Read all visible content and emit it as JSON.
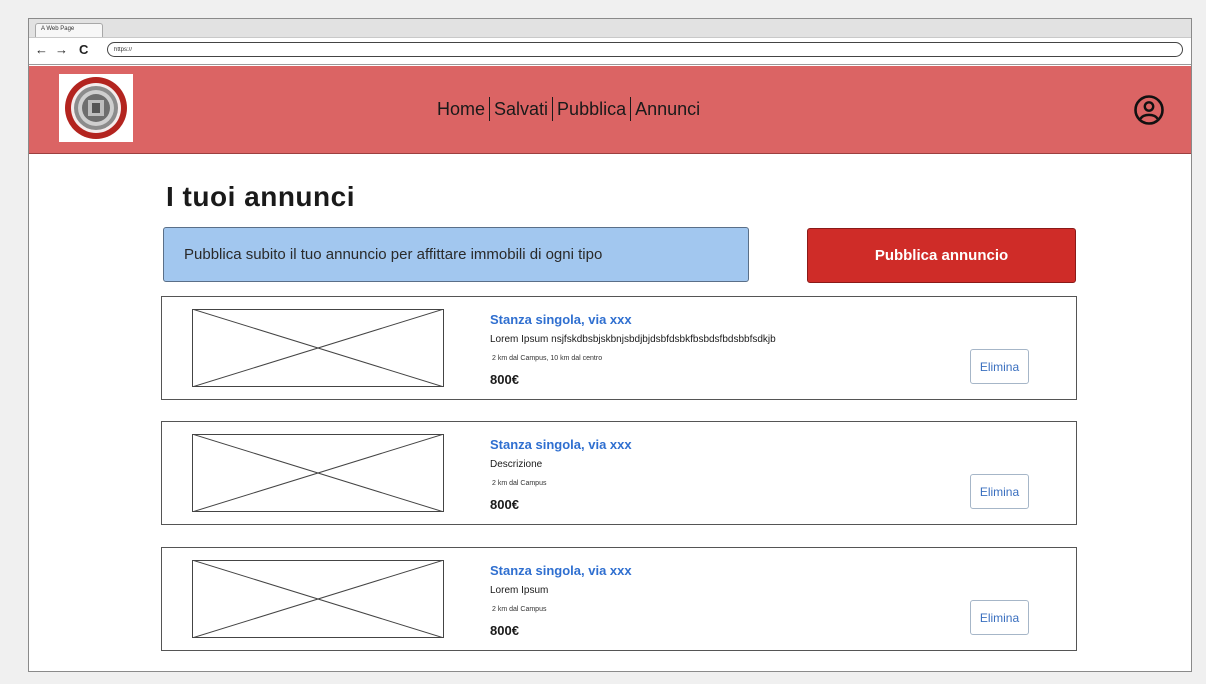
{
  "browser": {
    "tab_title": "A Web Page",
    "back_glyph": "←",
    "forward_glyph": "→",
    "reload_glyph": "C",
    "url": "https://"
  },
  "header": {
    "logo_icon": "university-seal-logo",
    "nav": [
      {
        "label": "Home"
      },
      {
        "label": "Salvati"
      },
      {
        "label": "Pubblica"
      },
      {
        "label": "Annunci"
      }
    ],
    "profile_icon": "user-circle-icon"
  },
  "main": {
    "title": "I tuoi annunci",
    "banner_text": "Pubblica subito il tuo annuncio per affittare immobili di ogni tipo",
    "publish_button": "Pubblica annuncio"
  },
  "listings": [
    {
      "title": "Stanza singola, via xxx",
      "description": "Lorem Ipsum nsjfskdbsbjskbnjsbdjbjdsbfdsbkfbsbdsfbdsbbfsdkjb",
      "distance": "2 km dal Campus, 10 km dal centro",
      "price": "800€",
      "delete_label": "Elimina"
    },
    {
      "title": "Stanza singola, via xxx",
      "description": "Descrizione",
      "distance": "2 km dal Campus",
      "price": "800€",
      "delete_label": "Elimina"
    },
    {
      "title": "Stanza singola, via xxx",
      "description": "Lorem Ipsum",
      "distance": "2 km dal Campus",
      "price": "800€",
      "delete_label": "Elimina"
    }
  ],
  "colors": {
    "header_bg": "#db6464",
    "accent_red": "#cf2c28",
    "banner_bg": "#a2c7ef",
    "title_blue": "#2f6fd0"
  }
}
